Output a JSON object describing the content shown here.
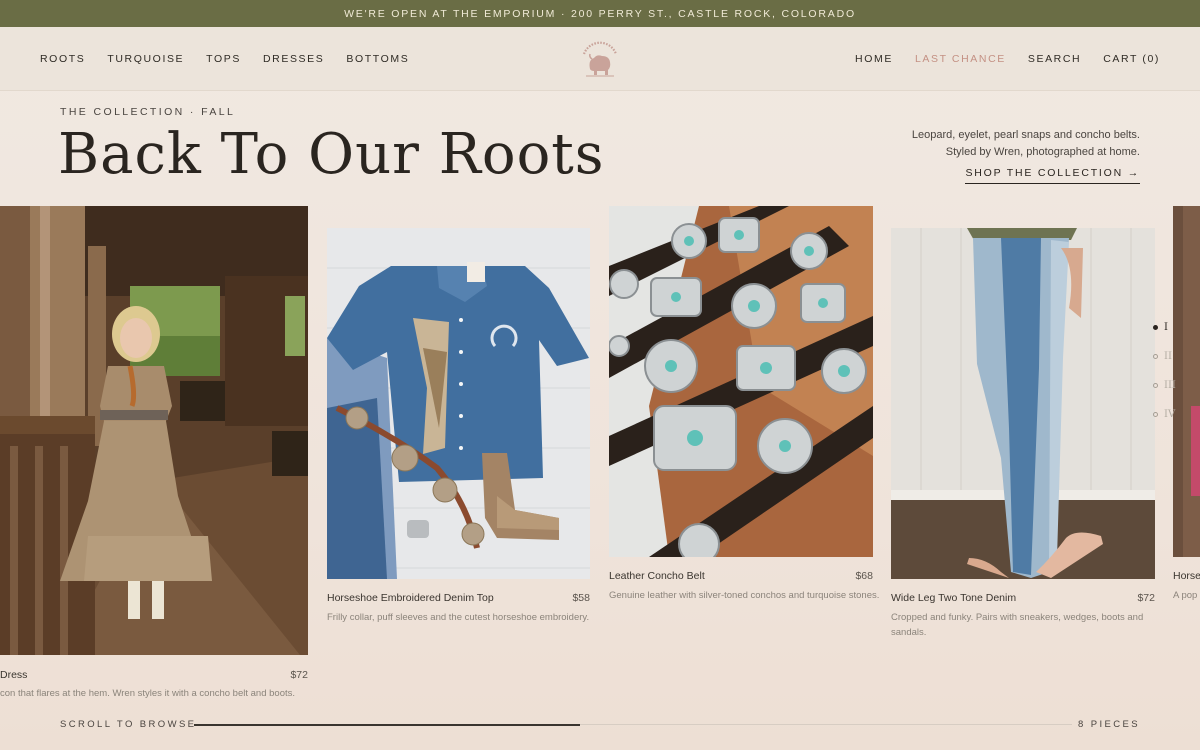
{
  "announcement": "WE'RE OPEN AT THE EMPORIUM · 200 PERRY ST., CASTLE ROCK, COLORADO",
  "nav": {
    "left": [
      "ROOTS",
      "TURQUOISE",
      "TOPS",
      "DRESSES",
      "BOTTOMS"
    ],
    "right": [
      "HOME",
      "LAST CHANCE",
      "SEARCH",
      "CART (0)"
    ]
  },
  "hero": {
    "eyebrow": "THE COLLECTION · FALL",
    "title": "Back To Our Roots",
    "desc_line1": "Leopard, eyelet, pearl snaps and concho belts.",
    "desc_line2": "Styled by Wren, photographed at home.",
    "cta": "SHOP THE COLLECTION →"
  },
  "products": [
    {
      "name": "Dress",
      "price": "$72",
      "desc": "con that flares at the hem. Wren styles it with a concho belt and boots."
    },
    {
      "name": "Horseshoe Embroidered Denim Top",
      "price": "$58",
      "desc": "Frilly collar, puff sleeves and the cutest horseshoe embroidery."
    },
    {
      "name": "Leather Concho Belt",
      "price": "$68",
      "desc": "Genuine leather with silver-toned conchos and turquoise stones."
    },
    {
      "name": "Wide Leg Two Tone Denim",
      "price": "$72",
      "desc": "Cropped and funky. Pairs with sneakers, wedges, boots and sandals."
    },
    {
      "name": "Horse",
      "price": "",
      "desc": "A pop"
    }
  ],
  "pager": [
    "I",
    "II",
    "III",
    "IV"
  ],
  "pager_active": 0,
  "scroll_label": "SCROLL TO BROWSE",
  "scroll_progress": 0.44,
  "pieces": "8 PIECES",
  "colors": {
    "announcement_bg": "#6a6d45",
    "accent": "#c49184",
    "background": "#f1e9e2"
  }
}
